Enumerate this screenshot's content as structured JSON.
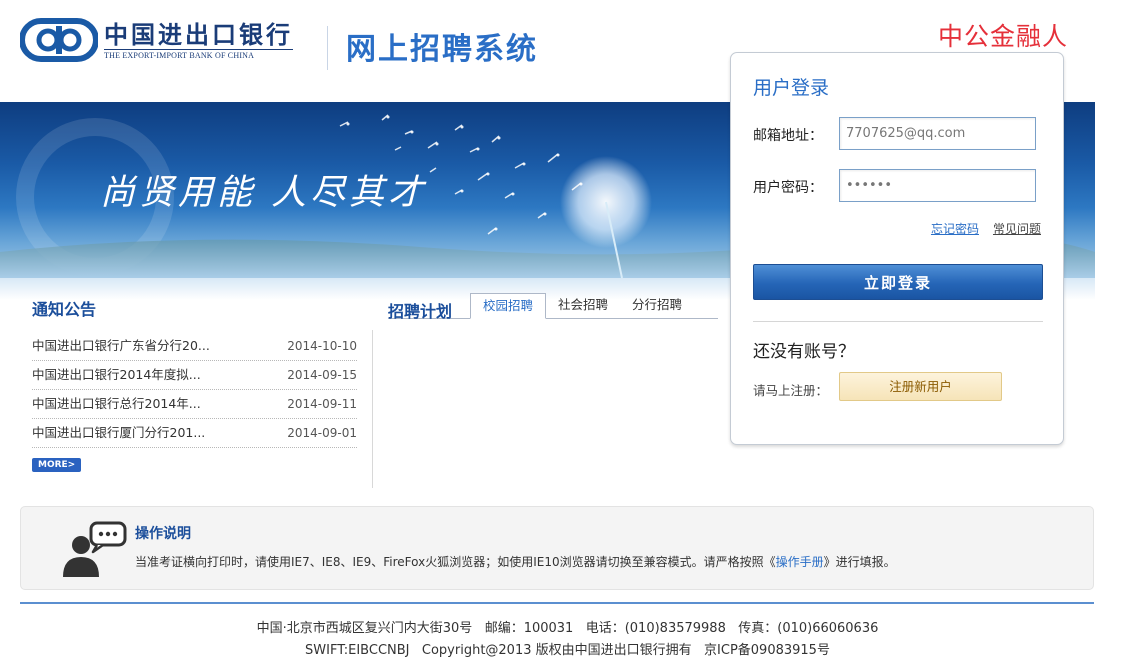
{
  "header": {
    "logo_cn": "中国进出口银行",
    "logo_en": "THE EXPORT-IMPORT BANK OF CHINA",
    "system_title": "网上招聘系统",
    "watermark": "中公金融人"
  },
  "banner": {
    "slogan": "尚贤用能 人尽其才"
  },
  "notices": {
    "title": "通知公告",
    "items": [
      {
        "title": "中国进出口银行广东省分行20...",
        "date": "2014-10-10"
      },
      {
        "title": "中国进出口银行2014年度拟...",
        "date": "2014-09-15"
      },
      {
        "title": "中国进出口银行总行2014年...",
        "date": "2014-09-11"
      },
      {
        "title": "中国进出口银行厦门分行201...",
        "date": "2014-09-01"
      }
    ],
    "more_label": "MORE>"
  },
  "plan": {
    "title": "招聘计划",
    "tabs": [
      "校园招聘",
      "社会招聘",
      "分行招聘"
    ],
    "active_tab": 0
  },
  "login": {
    "title": "用户登录",
    "email_label": "邮箱地址：",
    "email_value": "7707625@qq.com",
    "password_label": "用户密码：",
    "password_value": "••••••",
    "forgot_label": "忘记密码",
    "faq_label": "常见问题",
    "submit_label": "立即登录",
    "no_account": "还没有账号？",
    "register_hint": "请马上注册：",
    "register_label": "注册新用户"
  },
  "instructions": {
    "title": "操作说明",
    "text_before": "当准考证横向打印时，请使用IE7、IE8、IE9、FireFox火狐浏览器；如使用IE10浏览器请切换至兼容模式。请严格按照《",
    "link": "操作手册",
    "text_after": "》进行填报。"
  },
  "footer": {
    "line1": "中国·北京市西城区复兴门内大街30号   邮编：100031   电话：(010)83579988   传真：(010)66060636",
    "line2": "SWIFT:EIBCCNBJ   Copyright@2013 版权由中国进出口银行拥有   京ICP备09083915号"
  },
  "colors": {
    "brand_blue": "#2a6ec6",
    "navy": "#1a3c78",
    "watermark_red": "#e5303a"
  }
}
